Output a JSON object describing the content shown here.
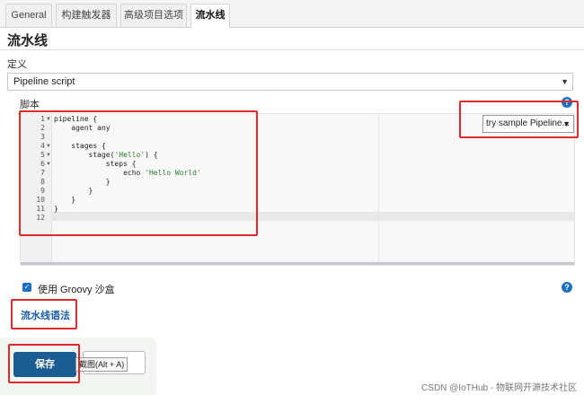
{
  "tabs": [
    {
      "label": "General"
    },
    {
      "label": "构建触发器"
    },
    {
      "label": "高级项目选项"
    },
    {
      "label": "流水线"
    }
  ],
  "section_title": "流水线",
  "definition": {
    "label": "定义",
    "selected": "Pipeline script"
  },
  "script": {
    "label": "脚本",
    "help": "?",
    "sample_selected": "try sample Pipeline...",
    "line_numbers": [
      "1",
      "2",
      "3",
      "4",
      "5",
      "6",
      "7",
      "8",
      "9",
      "10",
      "11",
      "12"
    ],
    "code_lines": [
      "pipeline {",
      "    agent any",
      "",
      "    stages {",
      "        stage('Hello') {",
      "            steps {",
      "                echo 'Hello World'",
      "            }",
      "        }",
      "    }",
      "}",
      ""
    ]
  },
  "groovy": {
    "label": "使用 Groovy 沙盒",
    "checked": true,
    "help": "?"
  },
  "syntax_link": "流水线语法",
  "buttons": {
    "save": "保存",
    "tooltip": "截图(Alt + A)"
  },
  "watermark": "CSDN @IoTHub - 物联网开源技术社区",
  "colors": {
    "accent": "#1b5d92",
    "link": "#1a5da8",
    "highlight": "#e0292b"
  }
}
